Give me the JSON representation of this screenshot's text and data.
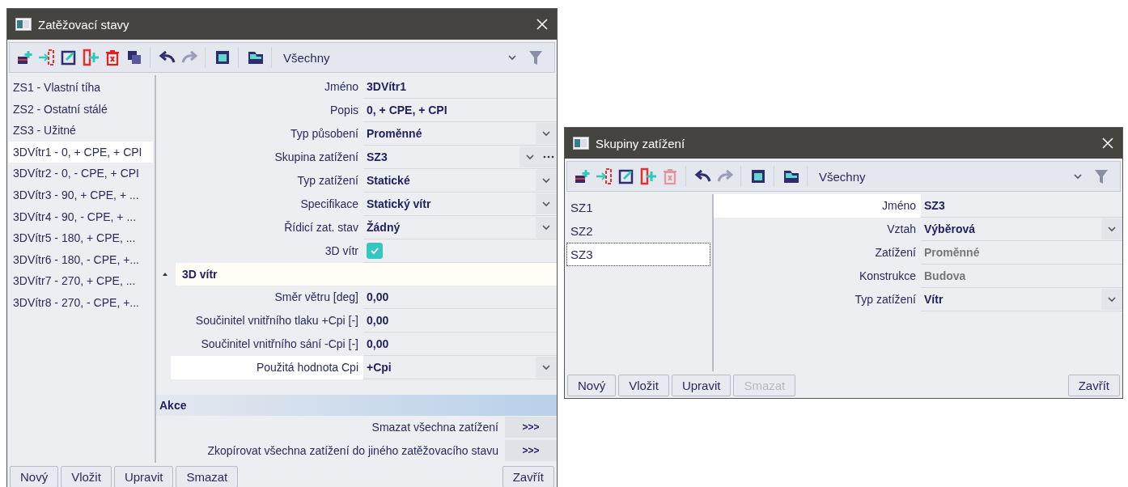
{
  "windows": [
    {
      "title": "Zatěžovací stavy",
      "toolbar": {
        "groups": [
          [
            {
              "kind": "add",
              "disabled": false
            },
            {
              "kind": "insert",
              "disabled": false
            },
            {
              "kind": "edit",
              "disabled": false
            },
            {
              "kind": "split",
              "disabled": false
            },
            {
              "kind": "delete",
              "disabled": false
            },
            {
              "kind": "copy",
              "disabled": false
            }
          ],
          [
            {
              "kind": "undo",
              "disabled": false
            },
            {
              "kind": "redo",
              "disabled": true
            }
          ],
          [
            {
              "kind": "archive",
              "disabled": false
            }
          ],
          [
            {
              "kind": "save",
              "disabled": false
            }
          ]
        ],
        "filter": "Všechny"
      },
      "list": [
        {
          "label": "ZS1 - Vlastní tíha",
          "selected": false
        },
        {
          "label": "ZS2 - Ostatní stálé",
          "selected": false
        },
        {
          "label": "ZS3 - Užitné",
          "selected": false
        },
        {
          "label": "3DVítr1 - 0, + CPE, + CPI",
          "selected": true
        },
        {
          "label": "3DVítr2 - 0, - CPE, + CPI",
          "selected": false
        },
        {
          "label": "3DVítr3 - 90, + CPE, + ...",
          "selected": false
        },
        {
          "label": "3DVítr4 - 90, - CPE, + ...",
          "selected": false
        },
        {
          "label": "3DVítr5 - 180, + CPE, ...",
          "selected": false
        },
        {
          "label": "3DVítr6 - 180, - CPE, +...",
          "selected": false
        },
        {
          "label": "3DVítr7 - 270, + CPE, ...",
          "selected": false
        },
        {
          "label": "3DVítr8 - 270, - CPE, +...",
          "selected": false
        }
      ],
      "properties": [
        {
          "label": "Jméno",
          "value": "3DVítr1",
          "kind": "text",
          "selected": false
        },
        {
          "label": "Popis",
          "value": "0, + CPE, + CPI",
          "kind": "text",
          "selected": false
        },
        {
          "label": "Typ působení",
          "value": "Proměnné",
          "kind": "dropdown",
          "selected": false
        },
        {
          "label": "Skupina zatížení",
          "value": "SZ3",
          "kind": "dropdown_more",
          "selected": false
        },
        {
          "label": "Typ zatížení",
          "value": "Statické",
          "kind": "dropdown",
          "selected": false
        },
        {
          "label": "Specifikace",
          "value": "Statický vítr",
          "kind": "dropdown",
          "selected": false
        },
        {
          "label": "Řídicí zat. stav",
          "value": "Žádný",
          "kind": "dropdown",
          "selected": false
        },
        {
          "label": "3D vítr",
          "kind": "checkbox",
          "checked": true,
          "selected": false
        }
      ],
      "section": {
        "title": "3D vítr",
        "expanded": true,
        "properties": [
          {
            "label": "Směr větru [deg]",
            "value": "0,00",
            "kind": "text",
            "selected": false
          },
          {
            "label": "Součinitel vnitřního tlaku +Cpi [-]",
            "value": "0,00",
            "kind": "text",
            "selected": false
          },
          {
            "label": "Součinitel vnitřního sání -Cpi [-]",
            "value": "0,00",
            "kind": "text",
            "selected": false
          },
          {
            "label": "Použitá hodnota Cpi",
            "value": "+Cpi",
            "kind": "dropdown",
            "selected": true
          }
        ]
      },
      "actions": {
        "title": "Akce",
        "items": [
          {
            "label": "Smazat všechna zatížení",
            "button": ">>>"
          },
          {
            "label": "Zkopírovat všechna zatížení do jiného zatěžovacího stavu",
            "button": ">>>"
          }
        ]
      },
      "buttons": [
        {
          "label": "Nový",
          "disabled": false
        },
        {
          "label": "Vložit",
          "disabled": false
        },
        {
          "label": "Upravit",
          "disabled": false
        },
        {
          "label": "Smazat",
          "disabled": false
        }
      ],
      "close_button": "Zavřít"
    },
    {
      "title": "Skupiny zatížení",
      "toolbar": {
        "groups": [
          [
            {
              "kind": "add",
              "disabled": false
            },
            {
              "kind": "insert",
              "disabled": false
            },
            {
              "kind": "edit",
              "disabled": false
            },
            {
              "kind": "split",
              "disabled": false
            },
            {
              "kind": "delete",
              "disabled": true
            }
          ],
          [
            {
              "kind": "undo",
              "disabled": false
            },
            {
              "kind": "redo",
              "disabled": true
            }
          ],
          [
            {
              "kind": "archive",
              "disabled": false
            }
          ],
          [
            {
              "kind": "save",
              "disabled": false
            }
          ]
        ],
        "filter": "Všechny"
      },
      "list": [
        {
          "label": "SZ1",
          "selected": false
        },
        {
          "label": "SZ2",
          "selected": false
        },
        {
          "label": "SZ3",
          "selected": true
        }
      ],
      "properties": [
        {
          "label": "Jméno",
          "value": "SZ3",
          "kind": "text",
          "selected": true
        },
        {
          "label": "Vztah",
          "value": "Výběrová",
          "kind": "dropdown",
          "selected": false
        },
        {
          "label": "Zatížení",
          "value": "Proměnné",
          "kind": "readonly",
          "selected": false
        },
        {
          "label": "Konstrukce",
          "value": "Budova",
          "kind": "readonly",
          "selected": false
        },
        {
          "label": "Typ zatížení",
          "value": "Vítr",
          "kind": "dropdown",
          "selected": false
        }
      ],
      "buttons": [
        {
          "label": "Nový",
          "disabled": false
        },
        {
          "label": "Vložit",
          "disabled": false
        },
        {
          "label": "Upravit",
          "disabled": false
        },
        {
          "label": "Smazat",
          "disabled": true
        }
      ],
      "close_button": "Zavřít"
    }
  ]
}
